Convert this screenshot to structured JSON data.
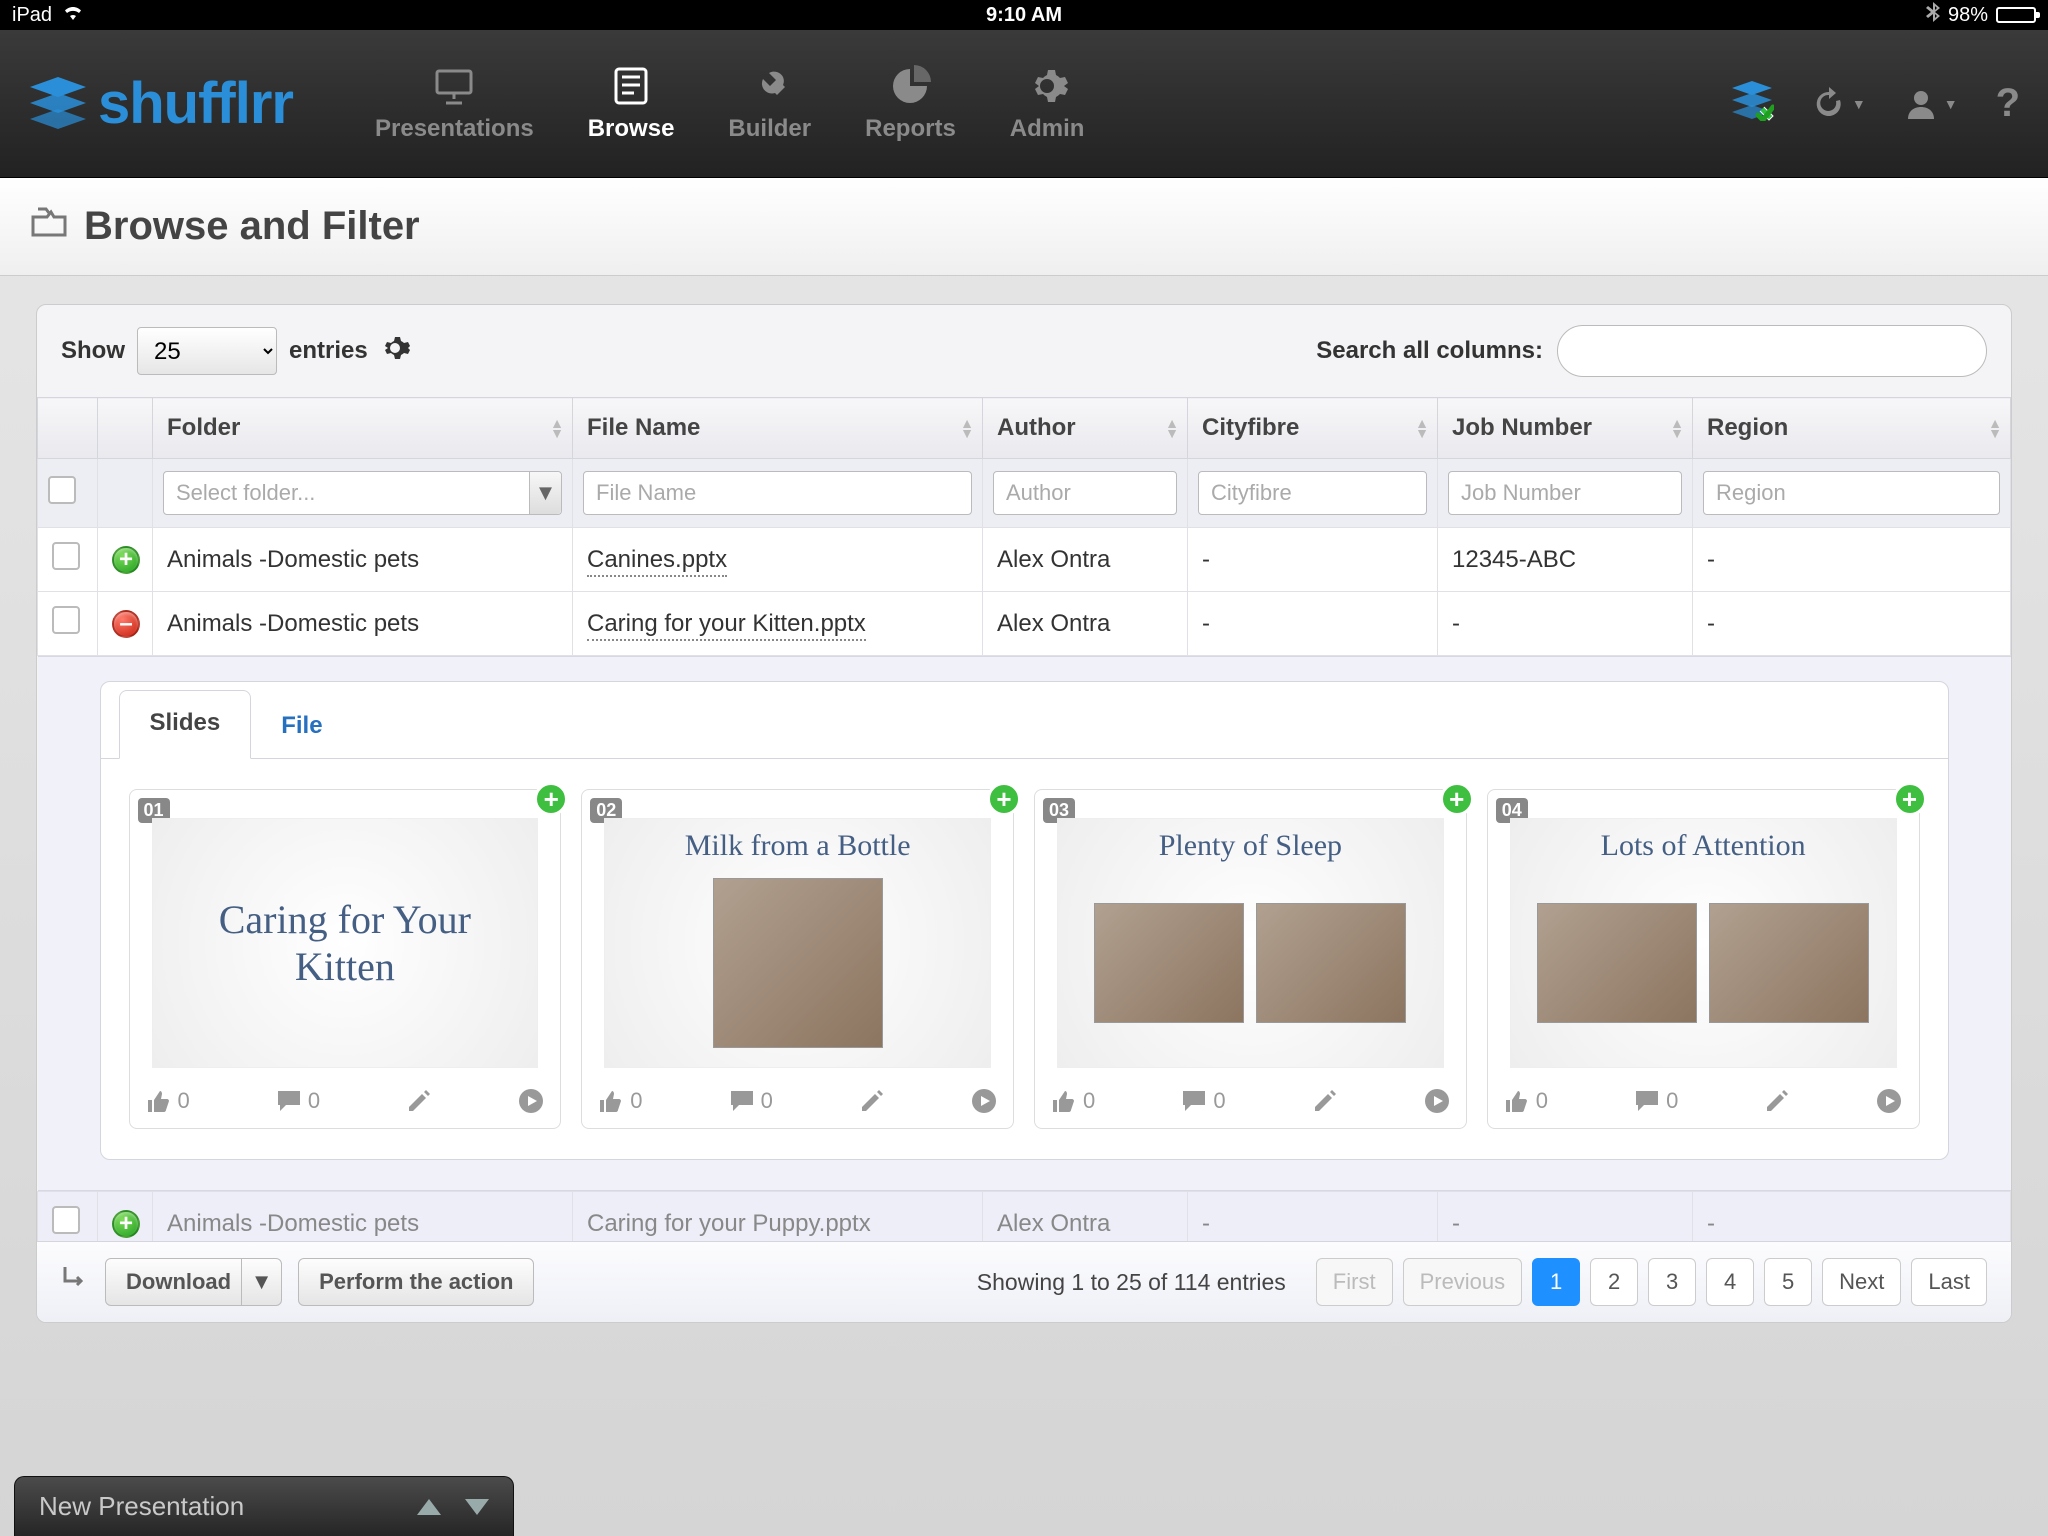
{
  "status_bar": {
    "device": "iPad",
    "time": "9:10 AM",
    "battery": "98%"
  },
  "nav": {
    "logo": "shufflrr",
    "items": [
      "Presentations",
      "Browse",
      "Builder",
      "Reports",
      "Admin"
    ],
    "help": "?"
  },
  "page": {
    "title": "Browse and Filter"
  },
  "table_controls": {
    "show_label": "Show",
    "entries_label": "entries",
    "page_size": "25",
    "search_label": "Search all columns:"
  },
  "columns": {
    "folder": "Folder",
    "file": "File Name",
    "author": "Author",
    "city": "Cityfibre",
    "job": "Job Number",
    "region": "Region"
  },
  "filters": {
    "folder_placeholder": "Select folder...",
    "file_placeholder": "File Name",
    "author_placeholder": "Author",
    "city_placeholder": "Cityfibre",
    "job_placeholder": "Job Number",
    "region_placeholder": "Region"
  },
  "rows": [
    {
      "status": "green",
      "folder": "Animals -Domestic pets",
      "file": "Canines.pptx",
      "author": "Alex Ontra",
      "city": "-",
      "job": "12345-ABC",
      "region": "-"
    },
    {
      "status": "red",
      "folder": "Animals -Domestic pets",
      "file": "Caring for your Kitten.pptx",
      "author": "Alex Ontra",
      "city": "-",
      "job": "-",
      "region": "-"
    }
  ],
  "cutoff_row": {
    "status": "green",
    "folder": "Animals -Domestic pets",
    "file": "Caring for your Puppy.pptx",
    "author": "Alex Ontra",
    "city": "-",
    "job": "-",
    "region": "-"
  },
  "detail": {
    "tabs": {
      "slides": "Slides",
      "file": "File"
    },
    "slides": [
      {
        "num": "01",
        "title": "Caring for Your Kitten",
        "likes": "0",
        "comments": "0",
        "type": "title"
      },
      {
        "num": "02",
        "title": "Milk from a Bottle",
        "likes": "0",
        "comments": "0",
        "type": "one"
      },
      {
        "num": "03",
        "title": "Plenty of Sleep",
        "likes": "0",
        "comments": "0",
        "type": "two"
      },
      {
        "num": "04",
        "title": "Lots of Attention",
        "likes": "0",
        "comments": "0",
        "type": "two"
      }
    ]
  },
  "footer": {
    "download": "Download",
    "perform": "Perform the action",
    "showing": "Showing 1 to 25 of 114 entries",
    "first": "First",
    "prev": "Previous",
    "pages": [
      "1",
      "2",
      "3",
      "4",
      "5"
    ],
    "next": "Next",
    "last": "Last"
  },
  "bottom_bar": {
    "label": "New Presentation"
  }
}
